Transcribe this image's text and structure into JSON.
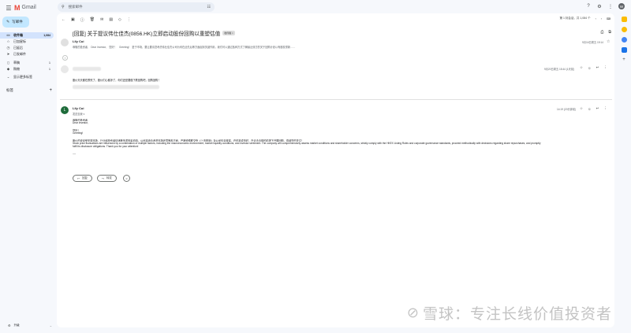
{
  "app": {
    "logo_text": "Gmail",
    "logo_letter": "M"
  },
  "search": {
    "placeholder": "搜索邮件"
  },
  "user": {
    "avatar_letter": "W"
  },
  "sidebar": {
    "compose_label": "写邮件",
    "items": [
      {
        "label": "收件箱",
        "count": "1,084",
        "icon": "inbox-icon",
        "glyph": "▭"
      },
      {
        "label": "已加星标",
        "count": "",
        "icon": "star-icon",
        "glyph": "☆"
      },
      {
        "label": "已延后",
        "count": "",
        "icon": "clock-icon",
        "glyph": "◷"
      },
      {
        "label": "已发邮件",
        "count": "",
        "icon": "send-icon",
        "glyph": "➤"
      },
      {
        "label": "草稿",
        "count": "1",
        "icon": "draft-icon",
        "glyph": "▯"
      },
      {
        "label": "购物",
        "count": "1",
        "icon": "tag-icon",
        "glyph": "◆"
      },
      {
        "label": "显示更多标签",
        "count": "",
        "icon": "chevron-down-icon",
        "glyph": "⌄"
      }
    ],
    "labels_heading": "标签",
    "labels_add": "+",
    "upgrade_label": "升级"
  },
  "toolbar": {
    "pager": "第 1 封会话，共 1,084 个"
  },
  "thread": {
    "subject": "[回复] 关于提议伟仕佳杰(0856.HK)立即启动股份回购以重塑估值",
    "subject_tag": "收件箱 ×",
    "messages": [
      {
        "sender": "Lily Cui",
        "avatar_letter": "",
        "snippet": "尊敬的投资者,　Dear Investor,　您好！　Greeting!　鉴于市场，要让要请您考虑伟仕佳杰公司为何在此先后等方面起到关键作用，我们可以通过各种方式了解最近双方的关于回购计划以有股权重新……",
        "date": "9月16日周五 19:14"
      },
      {
        "sender": "",
        "snippet": "",
        "date": "9月20日周五 15:44 (1天前)",
        "body": "股价天天都在跌死了，股价们心都凉了，你们还是要做下跌回购吧，回购回购！"
      },
      {
        "sender": "Lily Cui",
        "avatar_letter": "L",
        "to": "发送至我",
        "date": "14:19 (20分钟前)",
        "body": [
          "尊敬的投资者,",
          "Dear Investor,",
          "",
          "您好！",
          "Greeting!",
          "",
          "股价的波动受宏观市场、行业和投资者情绪等多重因素影响。公司将综合考虑市场环境等各方面，严格遵循联交所《上市规则》及公司信息披露，在时机成熟时，在合法合规的前提下开展回购，感谢您的关注！",
          "Stock price fluctuations are influenced by a combination of multiple factors, including the macroeconomic environment, market liquidity conditions, and investor sentiment. The company will comprehensively assess market conditions and shareholder concerns, strictly comply with the HKEX Listing Rules and corporate governance standards, proceed methodically with decisions regarding share repurchases, and promptly",
          "fulfil its disclosure obligations. Thank you for your attention!",
          "",
          "----"
        ]
      }
    ],
    "reply_label": "回复",
    "forward_label": "转发"
  },
  "watermark": "雪球：专注长线价值投资者"
}
